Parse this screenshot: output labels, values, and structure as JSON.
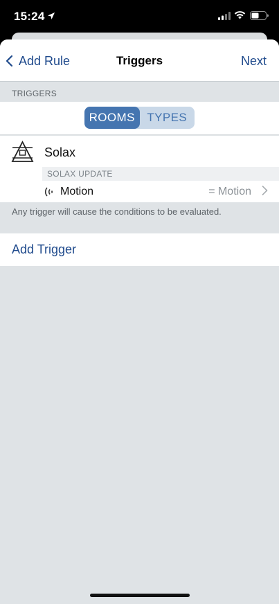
{
  "status_bar": {
    "time": "15:24",
    "icons": [
      "location-arrow-icon",
      "cellular-signal-icon",
      "wifi-icon",
      "battery-icon"
    ]
  },
  "nav": {
    "back_label": "Add Rule",
    "title": "Triggers",
    "next_label": "Next"
  },
  "section_header": "TRIGGERS",
  "segmented": {
    "options": [
      "ROOMS",
      "TYPES"
    ],
    "selected": "ROOMS"
  },
  "device": {
    "name": "Solax",
    "icon": "solar-inverter-icon",
    "event_header": "SOLAX UPDATE",
    "trigger": {
      "icon": "motion-waves-icon",
      "label": "Motion",
      "value": "= Motion"
    }
  },
  "footer_note": "Any trigger will cause the conditions to be evaluated.",
  "add_trigger_label": "Add Trigger",
  "colors": {
    "accent": "#1f4a8c",
    "segment_active": "#4575b0",
    "segment_track": "#c9d8e8",
    "background": "#dfe3e6"
  }
}
